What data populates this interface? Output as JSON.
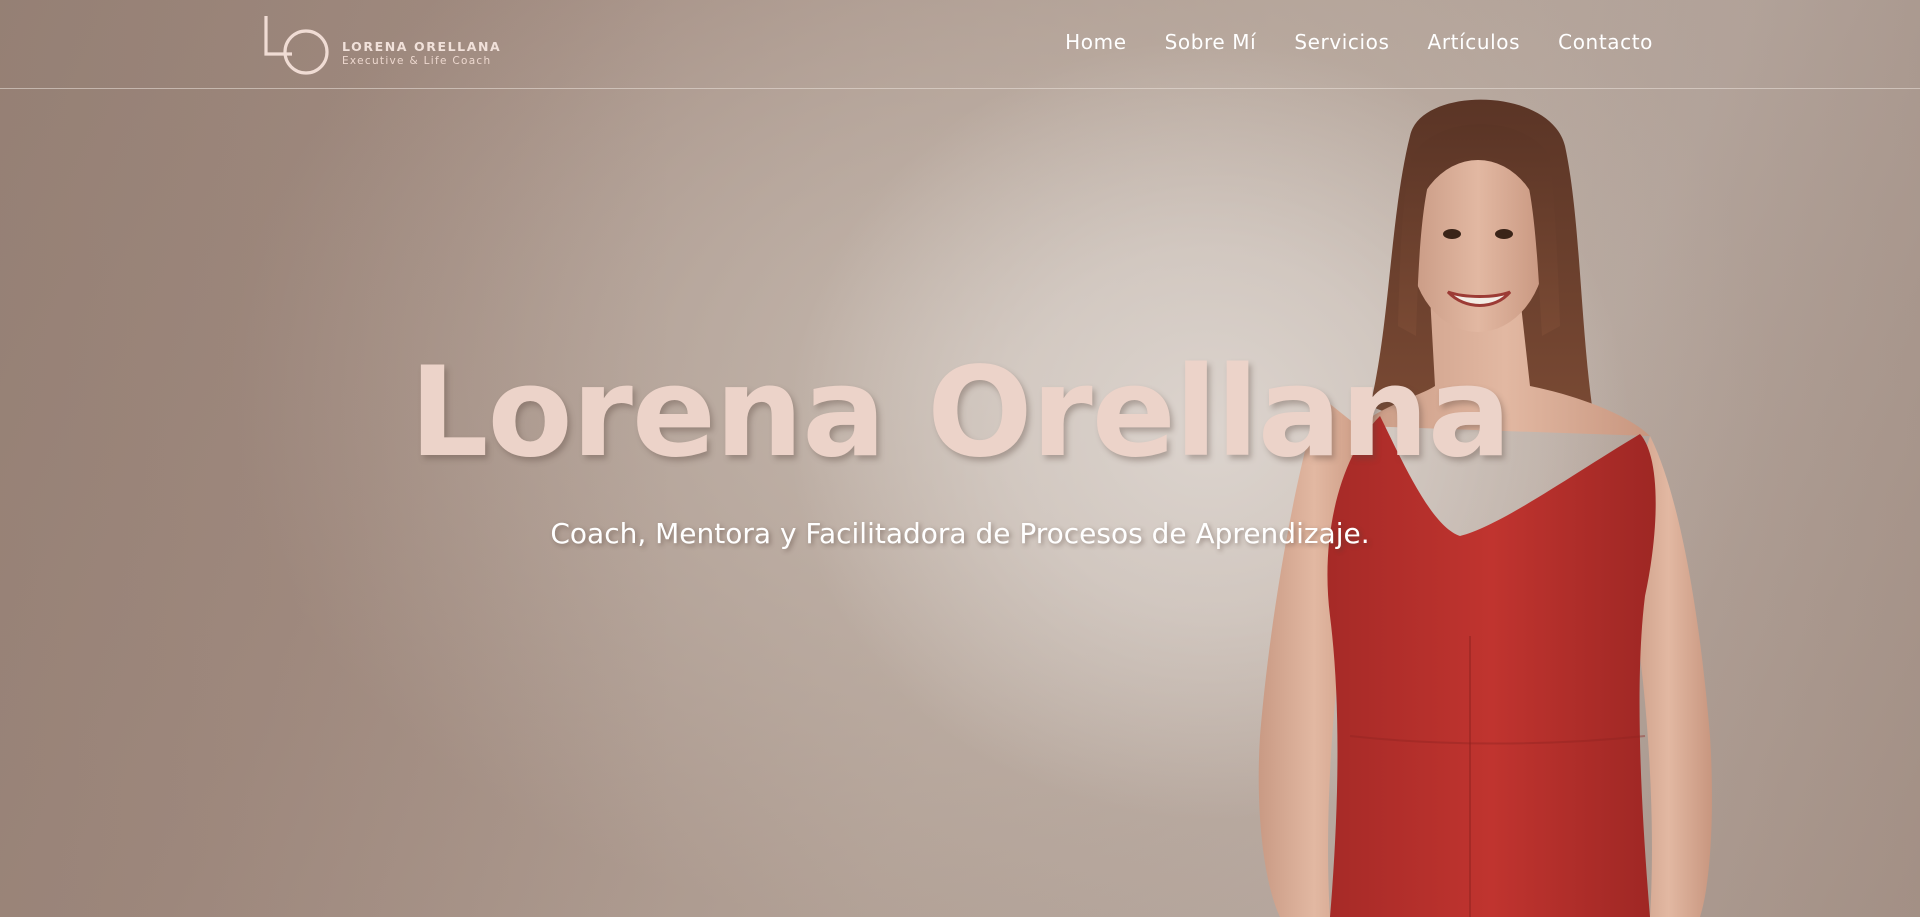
{
  "header": {
    "logo": {
      "monogram": "LO",
      "name": "LORENA ORELLANA",
      "tagline": "Executive & Life Coach"
    },
    "nav": [
      {
        "label": "Home"
      },
      {
        "label": "Sobre Mí"
      },
      {
        "label": "Servicios"
      },
      {
        "label": "Artículos"
      },
      {
        "label": "Contacto"
      }
    ]
  },
  "hero": {
    "title": "Lorena Orellana",
    "subtitle": "Coach, Mentora y Facilitadora de Procesos de Aprendizaje.",
    "photo_description_icon": "portrait-photo"
  },
  "colors": {
    "title": "#ecd3c9",
    "dress": "#b8302c",
    "background": "#a89488",
    "nav_text": "#ffffff"
  }
}
